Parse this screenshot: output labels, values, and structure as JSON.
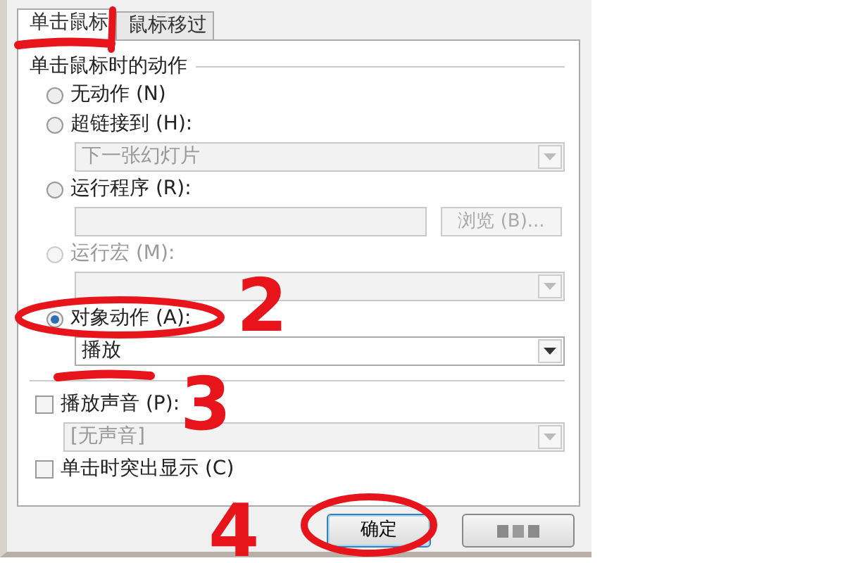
{
  "tabs": [
    {
      "label": "单击鼠标",
      "selected": true
    },
    {
      "label": "鼠标移过",
      "selected": false
    }
  ],
  "group": {
    "title": "单击鼠标时的动作",
    "options": [
      {
        "label": "无动作 (N)",
        "selected": false,
        "disabled": false
      },
      {
        "label": "超链接到 (H):",
        "selected": false,
        "disabled": false,
        "control": {
          "kind": "dropdown",
          "value": "下一张幻灯片",
          "disabled": true
        }
      },
      {
        "label": "运行程序 (R):",
        "selected": false,
        "disabled": false,
        "control": {
          "kind": "textfield",
          "disabled": true,
          "button": {
            "label": "浏览 (B)...",
            "disabled": true
          }
        }
      },
      {
        "label": "运行宏 (M):",
        "selected": false,
        "disabled": true,
        "control": {
          "kind": "dropdown",
          "disabled": true
        }
      },
      {
        "label": "对象动作 (A):",
        "selected": true,
        "disabled": false,
        "control": {
          "kind": "dropdown",
          "value": "播放",
          "disabled": false
        }
      }
    ]
  },
  "checks": [
    {
      "label": "播放声音 (P):",
      "checked": false,
      "control": {
        "kind": "dropdown",
        "value": "[无声音]",
        "disabled": true
      }
    },
    {
      "label": "单击时突出显示 (C)",
      "checked": false
    }
  ],
  "buttons": [
    {
      "kind": "default",
      "label": "确定"
    },
    {
      "kind": "obscured"
    }
  ],
  "annotations": [
    {
      "kind": "underline"
    },
    {
      "kind": "stroke"
    },
    {
      "kind": "ellipse"
    },
    {
      "kind": "digit",
      "text": "2"
    },
    {
      "kind": "underline"
    },
    {
      "kind": "digit",
      "text": "3"
    },
    {
      "kind": "digit",
      "text": "4"
    },
    {
      "kind": "ellipse"
    }
  ]
}
